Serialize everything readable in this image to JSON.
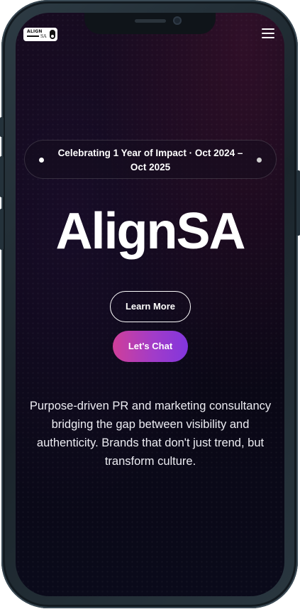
{
  "header": {
    "logo": {
      "line1": "ALIGN",
      "line2": "SA"
    },
    "menu_icon": "hamburger-menu-icon"
  },
  "hero": {
    "announcement": "Celebrating 1 Year of Impact · Oct 2024 – Oct 2025",
    "title": "AlignSA",
    "primary_button": "Learn More",
    "secondary_button": "Let's Chat",
    "tagline": "Purpose-driven PR and marketing consultancy bridging the gap between visibility and authenticity. Brands that don't just trend, but transform culture."
  },
  "colors": {
    "background": "#0d0718",
    "accent_gradient_start": "#cf3f9a",
    "accent_gradient_end": "#8236dd",
    "text": "#ffffff"
  }
}
